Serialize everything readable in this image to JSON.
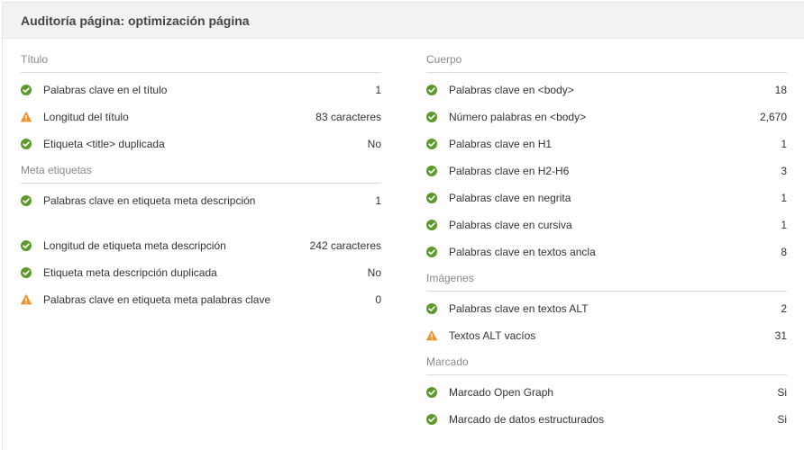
{
  "header": {
    "title": "Auditoría página: optimización página"
  },
  "colors": {
    "ok": "#5b9a2a",
    "warn": "#f0922a"
  },
  "left": {
    "sections": [
      {
        "title": "Título",
        "rows": [
          {
            "status": "ok",
            "label": "Palabras clave en el título",
            "value": "1"
          },
          {
            "status": "warn",
            "label": "Longitud del título",
            "value": "83 caracteres"
          },
          {
            "status": "ok",
            "label": "Etiqueta <title> duplicada",
            "value": "No"
          }
        ]
      },
      {
        "title": "Meta etiquetas",
        "rows": [
          {
            "status": "ok",
            "label": "Palabras clave en etiqueta meta descripción",
            "value": "1"
          },
          {
            "status": "ok",
            "label": "Longitud de etiqueta meta descripción",
            "value": "242 caracteres"
          },
          {
            "status": "ok",
            "label": "Etiqueta meta descripción duplicada",
            "value": "No"
          },
          {
            "status": "warn",
            "label": "Palabras clave en etiqueta meta palabras clave",
            "value": "0"
          }
        ]
      }
    ]
  },
  "right": {
    "sections": [
      {
        "title": "Cuerpo",
        "rows": [
          {
            "status": "ok",
            "label": "Palabras clave en <body>",
            "value": "18"
          },
          {
            "status": "ok",
            "label": "Número palabras en <body>",
            "value": "2,670"
          },
          {
            "status": "ok",
            "label": "Palabras clave en H1",
            "value": "1"
          },
          {
            "status": "ok",
            "label": "Palabras clave en H2-H6",
            "value": "3"
          },
          {
            "status": "ok",
            "label": "Palabras clave en negrita",
            "value": "1"
          },
          {
            "status": "ok",
            "label": "Palabras clave en cursiva",
            "value": "1"
          },
          {
            "status": "ok",
            "label": "Palabras clave en textos ancla",
            "value": "8"
          }
        ]
      },
      {
        "title": "Imágenes",
        "rows": [
          {
            "status": "ok",
            "label": "Palabras clave en textos ALT",
            "value": "2"
          },
          {
            "status": "warn",
            "label": "Textos ALT vacíos",
            "value": "31"
          }
        ]
      },
      {
        "title": "Marcado",
        "rows": [
          {
            "status": "ok",
            "label": "Marcado Open Graph",
            "value": "Si"
          },
          {
            "status": "ok",
            "label": "Marcado de datos estructurados",
            "value": "Si"
          }
        ]
      }
    ]
  }
}
